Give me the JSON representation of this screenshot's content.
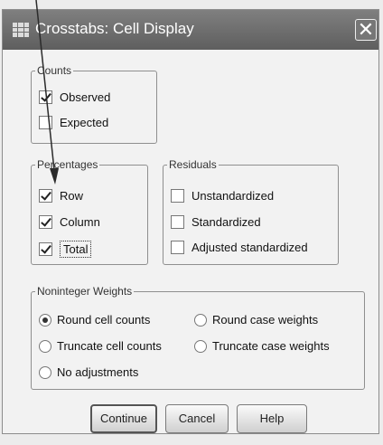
{
  "title": "Crosstabs: Cell Display",
  "close_glyph": "✕",
  "counts": {
    "title": "Counts",
    "options": [
      {
        "label": "Observed",
        "checked": true
      },
      {
        "label": "Expected",
        "checked": false
      }
    ]
  },
  "percentages": {
    "title": "Percentages",
    "options": [
      {
        "label": "Row",
        "checked": true
      },
      {
        "label": "Column",
        "checked": true
      },
      {
        "label": "Total",
        "checked": true
      }
    ]
  },
  "residuals": {
    "title": "Residuals",
    "options": [
      {
        "label": "Unstandardized",
        "checked": false
      },
      {
        "label": "Standardized",
        "checked": false
      },
      {
        "label": "Adjusted standardized",
        "checked": false
      }
    ]
  },
  "weights": {
    "title": "Noninteger Weights",
    "options": [
      {
        "label": "Round cell counts",
        "selected": true
      },
      {
        "label": "Round case weights",
        "selected": false
      },
      {
        "label": "Truncate cell counts",
        "selected": false
      },
      {
        "label": "Truncate case weights",
        "selected": false
      },
      {
        "label": "No adjustments",
        "selected": false
      }
    ]
  },
  "buttons": {
    "continue": "Continue",
    "cancel": "Cancel",
    "help": "Help"
  },
  "colors": {
    "titlebar": "#6e6e6e",
    "annotation_arrow": "#2b2b2b"
  }
}
